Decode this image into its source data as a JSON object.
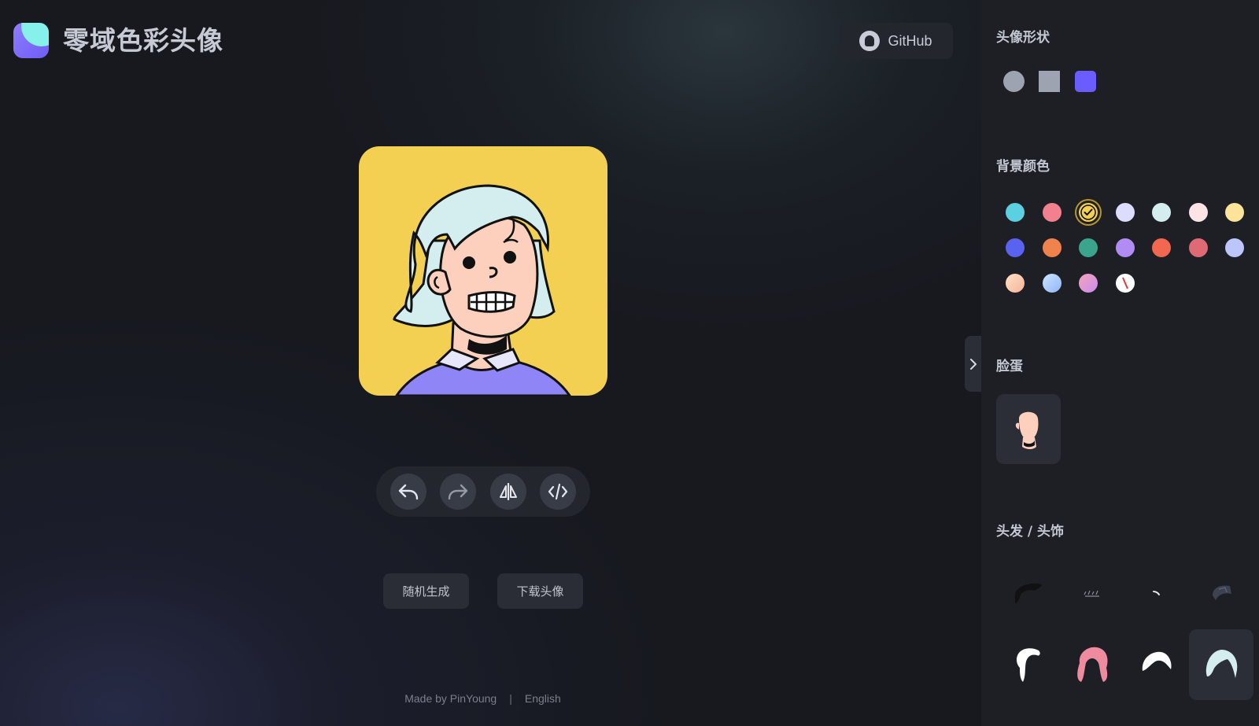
{
  "app": {
    "title": "零域色彩头像"
  },
  "header": {
    "github_label": "GitHub"
  },
  "toolbar": {
    "undo": "undo-icon",
    "redo": "redo-icon",
    "flip": "flip-icon",
    "code": "code-icon"
  },
  "actions": {
    "random_label": "随机生成",
    "download_label": "下载头像"
  },
  "footer": {
    "made_by": "Made by PinYoung",
    "separator": "|",
    "language": "English"
  },
  "sidebar": {
    "shape_title": "头像形状",
    "shapes": [
      {
        "name": "circle",
        "color": "#9da3b0"
      },
      {
        "name": "square",
        "color": "#9da3b0"
      },
      {
        "name": "squircle",
        "color": "#6b5cff",
        "selected": true
      }
    ],
    "bg_title": "背景颜色",
    "bg_colors": [
      "#5ccfe0",
      "#f2808f",
      "#f3d052",
      "#dcdcfd",
      "#d4eef0",
      "#fbe3e6",
      "#fbe39a",
      "#5a63ef",
      "#f0824e",
      "#3aa48c",
      "#b38bf5",
      "#f1674f",
      "#de6a76",
      "#bcc6fb",
      "gradient-peach",
      "gradient-blue",
      "gradient-pink",
      "none"
    ],
    "bg_selected": 2,
    "face_title": "脸蛋",
    "hair_title": "头发 / 头饰"
  },
  "avatar": {
    "background": "#f3d052",
    "hair_color": "#d4eef0",
    "skin_color": "#fcd0bd",
    "shirt_color": "#8f85f6"
  }
}
